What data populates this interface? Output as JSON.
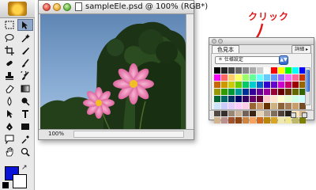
{
  "document": {
    "title": "sampleEle.psd @ 100% (RGB*)",
    "zoom": "100%"
  },
  "annotation": {
    "label": "クリック"
  },
  "palette": {
    "tab_label": "色見本",
    "detail_button": "詳細 ▸",
    "preset_value": "＊ 仕様設定",
    "swatch_colors": [
      "#000000",
      "#222222",
      "#444444",
      "#666666",
      "#888888",
      "#aaaaaa",
      "#cccccc",
      "#ffffff",
      "#ff0000",
      "#ffff00",
      "#00ff00",
      "#00ffff",
      "#0000ff",
      "#ff00ff",
      "#ff6666",
      "#ffcc66",
      "#ffff66",
      "#99ff66",
      "#66ff99",
      "#66ffff",
      "#66ccff",
      "#6699ff",
      "#9966ff",
      "#ff66ff",
      "#ff6699",
      "#cc3300",
      "#cc6600",
      "#cc9900",
      "#cccc00",
      "#66cc00",
      "#00cc66",
      "#00cccc",
      "#0066cc",
      "#3300cc",
      "#6600cc",
      "#cc00cc",
      "#cc0066",
      "#990000",
      "#996600",
      "#999900",
      "#339900",
      "#009933",
      "#009999",
      "#003399",
      "#330099",
      "#660099",
      "#990099",
      "#990033",
      "#660000",
      "#663300",
      "#666600",
      "#336600",
      "#006633",
      "#006666",
      "#003366",
      "#000066",
      "#330066",
      "#660066",
      "#660033",
      "#ffcccc",
      "#ffe5cc",
      "#ffffcc",
      "#e5ffcc",
      "#ccffe5",
      "#ccffff",
      "#cce5ff",
      "#ccccff",
      "#e5ccff",
      "#ffccff",
      "#ffcce5",
      "#996633",
      "#cc9966",
      "#663300",
      "#ccb27f",
      "#8c6239",
      "#a67c52",
      "#c69c6d",
      "#754c24",
      "#534741",
      "#362f2d",
      "#998675",
      "#c7b299",
      "#736357",
      "#3c2415",
      "#e6d3b3",
      "#b3a08c",
      "#806c5b",
      "#4d4036",
      "#262019",
      "#ffe4b5",
      "#deb887",
      "#d2b48c",
      "#bc8f8f",
      "#a0522d",
      "#8b4513",
      "#cd853f",
      "#f4a460",
      "#d2691e",
      "#b8860b",
      "#daa520",
      "#eee8aa",
      "#f0e68c",
      "#bdb76b",
      "#808000"
    ]
  },
  "tools": {
    "list": [
      "marquee",
      "move",
      "lasso",
      "magic-wand",
      "crop",
      "slice",
      "healing-brush",
      "brush",
      "clone-stamp",
      "history-brush",
      "eraser",
      "gradient",
      "blur",
      "dodge",
      "path-selection",
      "type",
      "pen",
      "shape",
      "notes",
      "eyedropper",
      "hand",
      "zoom"
    ]
  },
  "colors": {
    "foreground": "#0a14d8",
    "background": "#ffffff",
    "annotation": "#e01a1a"
  }
}
